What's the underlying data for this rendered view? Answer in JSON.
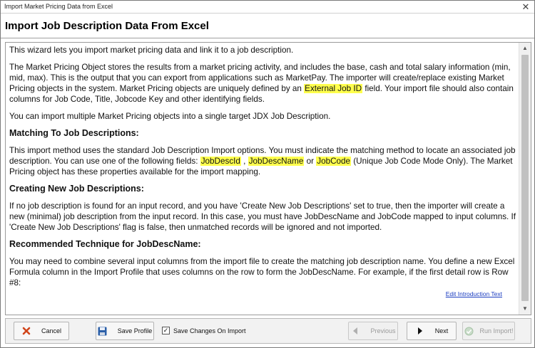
{
  "window": {
    "title": "Import Market Pricing Data from Excel",
    "close_glyph": "✕"
  },
  "header": {
    "title": "Import Job Description Data From Excel"
  },
  "content": {
    "intro": "This wizard lets you import market pricing data and link it to a job description.",
    "p2_a": "The Market Pricing Object stores the results from a market pricing activity, and includes the base, cash and total salary information (min, mid, max). This is the output that you can export from applications such as MarketPay. The importer will create/replace existing Market Pricing objects in the system. Market Pricing objects are uniquely defined by an ",
    "p2_hl": "External Job ID",
    "p2_b": " field. Your import file should also contain columns for Job Code, Title, Jobcode Key and other identifying fields.",
    "p3": "You can import multiple Market Pricing objects into a single target JDX Job Description.",
    "h_matching": "Matching To Job Descriptions:",
    "p4_a": "This import method uses the standard Job Description Import options. You must indicate the matching method to locate an associated job description. You can use one of the following fields: ",
    "p4_hl1": "JobDescId",
    "p4_sep1": " , ",
    "p4_hl2": "JobDescName",
    "p4_sep2": " or ",
    "p4_hl3": "JobCode",
    "p4_b": " (Unique Job Code Mode Only). The Market Pricing object has these properties available for the import mapping.",
    "h_creating": "Creating New Job Descriptions:",
    "p5": "If no job description is found for an input record, and you have 'Create New Job Descriptions' set to true, then the importer will create a new (minimal) job description from the input record. In this case, you must have JobDescName and JobCode mapped to input columns. If 'Create New Job Descriptions' flag is false, then unmatched records will be ignored and not imported.",
    "h_recommended": "Recommended Technique for JobDescName:",
    "p6": "You may need to combine several input columns from the import file to create the matching job description name. You define a new Excel Formula column in the Import Profile that uses columns on the row to form the JobDescName. For example, if the first detail row is Row #8:",
    "edit_link": "Edit Introduction Text"
  },
  "footer": {
    "cancel": "Cancel",
    "save_profile": "Save Profile",
    "save_changes": "Save Changes On Import",
    "save_changes_checked": true,
    "previous": "Previous",
    "next": "Next",
    "run_import": "Run Import!"
  },
  "colors": {
    "highlight": "#ffff4d",
    "link": "#1a3cc0"
  },
  "icons": {
    "cancel": "cancel-x-icon",
    "save": "floppy-disk-icon",
    "previous": "left-arrow-icon",
    "next": "right-arrow-icon",
    "run": "check-circle-icon"
  }
}
